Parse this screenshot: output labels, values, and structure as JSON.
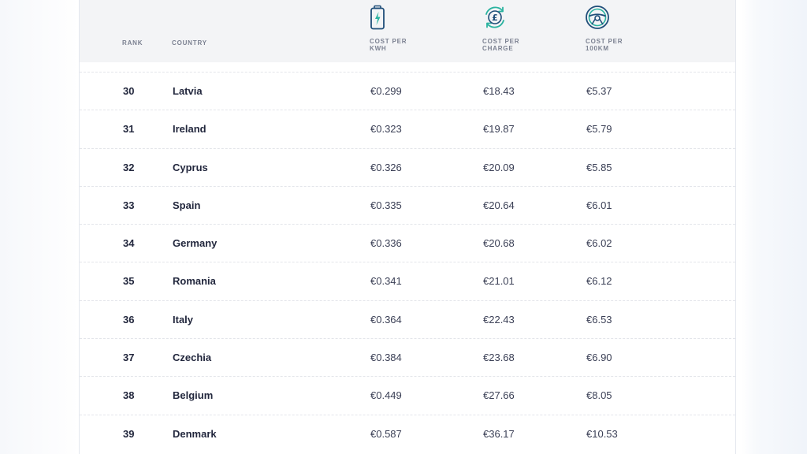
{
  "table": {
    "headers": {
      "rank": "RANK",
      "country": "COUNTRY",
      "kwh": [
        "COST PER",
        "KWH"
      ],
      "charge": [
        "COST PER",
        "CHARGE"
      ],
      "per100km": [
        "COST PER",
        "100KM"
      ]
    },
    "icons": {
      "kwh": "battery-charging-icon",
      "charge": "pound-refresh-icon",
      "per100km": "steering-wheel-icon"
    },
    "accent_color": "#1f4e79",
    "rows": [
      {
        "rank": "30",
        "country": "Latvia",
        "kwh": "€0.299",
        "charge": "€18.43",
        "per100km": "€5.37"
      },
      {
        "rank": "31",
        "country": "Ireland",
        "kwh": "€0.323",
        "charge": "€19.87",
        "per100km": "€5.79"
      },
      {
        "rank": "32",
        "country": "Cyprus",
        "kwh": "€0.326",
        "charge": "€20.09",
        "per100km": "€5.85"
      },
      {
        "rank": "33",
        "country": "Spain",
        "kwh": "€0.335",
        "charge": "€20.64",
        "per100km": "€6.01"
      },
      {
        "rank": "34",
        "country": "Germany",
        "kwh": "€0.336",
        "charge": "€20.68",
        "per100km": "€6.02"
      },
      {
        "rank": "35",
        "country": "Romania",
        "kwh": "€0.341",
        "charge": "€21.01",
        "per100km": "€6.12"
      },
      {
        "rank": "36",
        "country": "Italy",
        "kwh": "€0.364",
        "charge": "€22.43",
        "per100km": "€6.53"
      },
      {
        "rank": "37",
        "country": "Czechia",
        "kwh": "€0.384",
        "charge": "€23.68",
        "per100km": "€6.90"
      },
      {
        "rank": "38",
        "country": "Belgium",
        "kwh": "€0.449",
        "charge": "€27.66",
        "per100km": "€8.05"
      },
      {
        "rank": "39",
        "country": "Denmark",
        "kwh": "€0.587",
        "charge": "€36.17",
        "per100km": "€10.53"
      }
    ]
  }
}
